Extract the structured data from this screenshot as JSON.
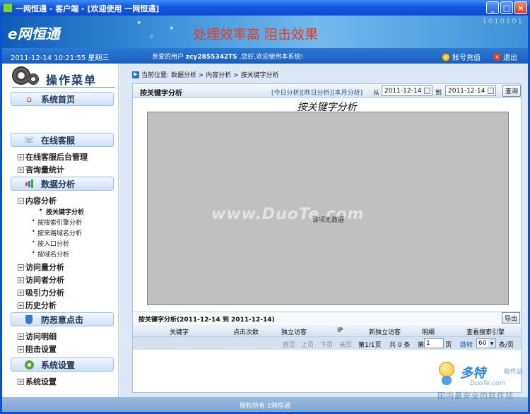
{
  "window": {
    "title": "一网恒通 - 客户端 - [欢迎使用 一网恒通]"
  },
  "banner": {
    "logo": "e网恒通",
    "slogan": "处理效率高   阻击效果",
    "binary": "1010101"
  },
  "infobar": {
    "datetime": "2011-12-14  10:21:55  星期三",
    "welcome_prefix": "亲爱的用户",
    "username": "zcy2855342TS",
    "welcome_suffix": ",您好,欢迎使用本系统!",
    "recharge": "账号充值",
    "logout": "退出"
  },
  "sidebar": {
    "header": "操作菜单",
    "sections": {
      "home": "系统首页",
      "online": "在线客服",
      "data": "数据分析",
      "defense": "防恶意点击",
      "settings": "系统设置"
    },
    "items": {
      "backend": "在线客服后台管理",
      "consult": "咨询量统计",
      "content": "内容分析",
      "visits": "访问量分析",
      "visitors": "访问者分析",
      "attraction": "吸引力分析",
      "history": "历史分析",
      "visit_detail": "访问明细",
      "block_settings": "阻击设置",
      "sys_settings": "系统设置"
    },
    "subitems": {
      "keyword": "按关键字分析",
      "engine": "按搜索引擎分析",
      "referrer": "按来路域名分析",
      "entry": "按入口分析",
      "domain": "按域名分析"
    }
  },
  "breadcrumb": {
    "label": "当前位置:",
    "path": "数据分析 > 内容分析 > 按关键字分析"
  },
  "toolbar": {
    "title": "按关键字分析",
    "today": "[今日分析]",
    "yesterday": "[昨日分析]",
    "month": "[本月分析]",
    "from": "从",
    "to": "到",
    "date_from": "2011-12-14",
    "date_to": "2011-12-14",
    "query": "查询"
  },
  "chart": {
    "title": "按关键字分析",
    "message": "该项无数据",
    "watermark": "www.DuoTe.com"
  },
  "summary": {
    "title": "按关键字分析(2011-12-14 到 2011-12-14)",
    "export": "导出"
  },
  "table": {
    "columns": [
      "关键字",
      "点击次数",
      "独立访客",
      "IP",
      "新独立访客",
      "明细",
      "查看搜索引擎"
    ]
  },
  "pager": {
    "first": "首页",
    "prev": "上页",
    "next": "下页",
    "last": "末页",
    "page_info": "第1/1页",
    "count": "共 0 条",
    "go_prefix": "第",
    "page_value": "1",
    "go_suffix": "页",
    "jump": "跳转",
    "size": "60",
    "per_page": "条/页"
  },
  "footer": {
    "copyright": "版权所有:E网恒通"
  },
  "site_logo": {
    "brand": "多特",
    "sub1": "软件站",
    "sub2": "DuoTe.com",
    "tag": "国内最安全的软件站"
  }
}
